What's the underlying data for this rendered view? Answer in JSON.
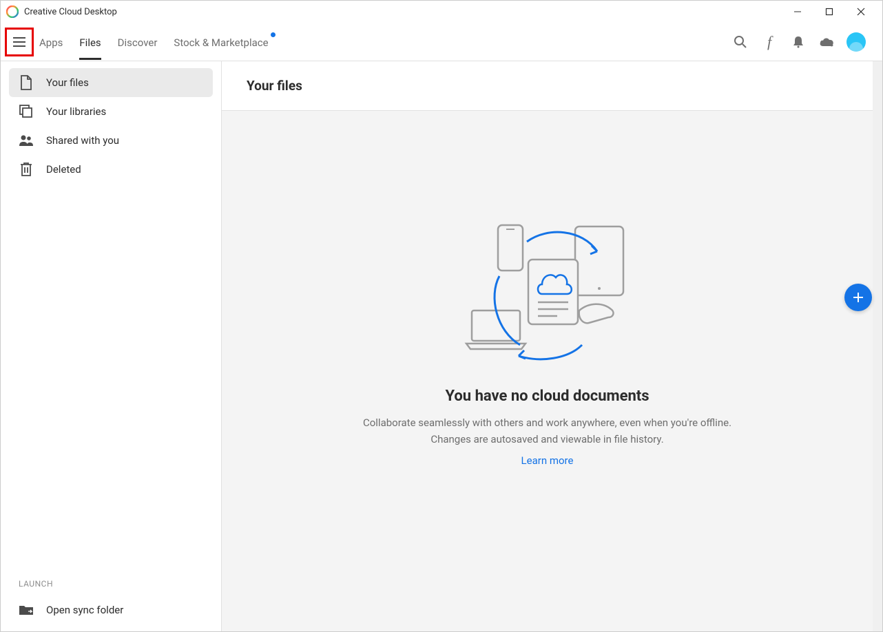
{
  "window": {
    "title": "Creative Cloud Desktop"
  },
  "nav": {
    "tabs": [
      "Apps",
      "Files",
      "Discover",
      "Stock & Marketplace"
    ],
    "active_index": 1,
    "dot_index": 3
  },
  "sidebar": {
    "items": [
      {
        "icon": "file",
        "label": "Your files"
      },
      {
        "icon": "libraries",
        "label": "Your libraries"
      },
      {
        "icon": "shared",
        "label": "Shared with you"
      },
      {
        "icon": "trash",
        "label": "Deleted"
      }
    ],
    "selected_index": 0,
    "section_label": "LAUNCH",
    "launch_item": {
      "label": "Open sync folder"
    }
  },
  "content": {
    "header": "Your files",
    "empty_title": "You have no cloud documents",
    "empty_desc": "Collaborate seamlessly with others and work anywhere, even when you're offline. Changes are autosaved and viewable in file history.",
    "learn_more": "Learn more"
  },
  "colors": {
    "accent": "#1473e6",
    "avatar": "#29c5f6",
    "highlight_border": "#e60000"
  }
}
